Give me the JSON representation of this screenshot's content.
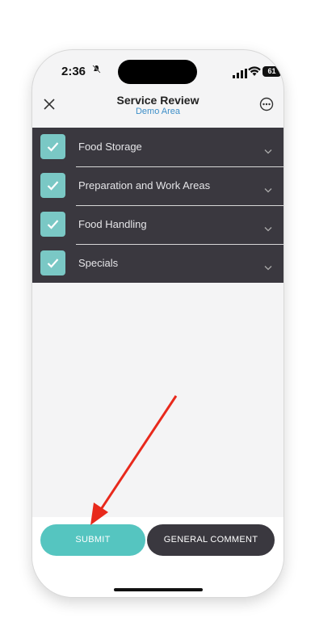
{
  "status_bar": {
    "time": "2:36",
    "silent_icon": "bell-slash-icon",
    "battery": "61"
  },
  "header": {
    "title": "Service Review",
    "subtitle": "Demo Area",
    "close_icon": "close-icon",
    "more_icon": "more-options-icon"
  },
  "sections": [
    {
      "label": "Food Storage",
      "checked": true
    },
    {
      "label": "Preparation and Work Areas",
      "checked": true
    },
    {
      "label": "Food Handling",
      "checked": true
    },
    {
      "label": "Specials",
      "checked": true
    }
  ],
  "footer": {
    "submit_label": "SUBMIT",
    "comment_label": "GENERAL COMMENT"
  },
  "colors": {
    "accent": "#55c5c0",
    "check": "#7ac8c5",
    "dark": "#3a383f",
    "subtitle": "#3e8fc8",
    "annotation_arrow": "#e8291c"
  }
}
